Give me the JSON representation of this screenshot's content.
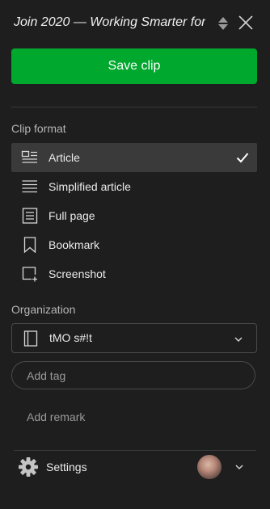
{
  "header": {
    "title": "Join 2020 — Working Smarter for",
    "sort_icon": "sort-updown-icon",
    "close_icon": "close-icon"
  },
  "actions": {
    "save_label": "Save clip",
    "accent_color": "#00a82d"
  },
  "clip_format": {
    "section_label": "Clip format",
    "selected": "Article",
    "items": [
      {
        "label": "Article",
        "icon": "article-icon"
      },
      {
        "label": "Simplified article",
        "icon": "simplified-article-icon"
      },
      {
        "label": "Full page",
        "icon": "full-page-icon"
      },
      {
        "label": "Bookmark",
        "icon": "bookmark-icon"
      },
      {
        "label": "Screenshot",
        "icon": "screenshot-icon"
      }
    ]
  },
  "organization": {
    "section_label": "Organization",
    "notebook": "tMO s#!t",
    "notebook_icon": "notebook-icon"
  },
  "tags": {
    "placeholder": "Add tag"
  },
  "remark": {
    "placeholder": "Add remark"
  },
  "footer": {
    "settings_label": "Settings",
    "settings_icon": "gear-icon",
    "avatar": "user-avatar"
  }
}
